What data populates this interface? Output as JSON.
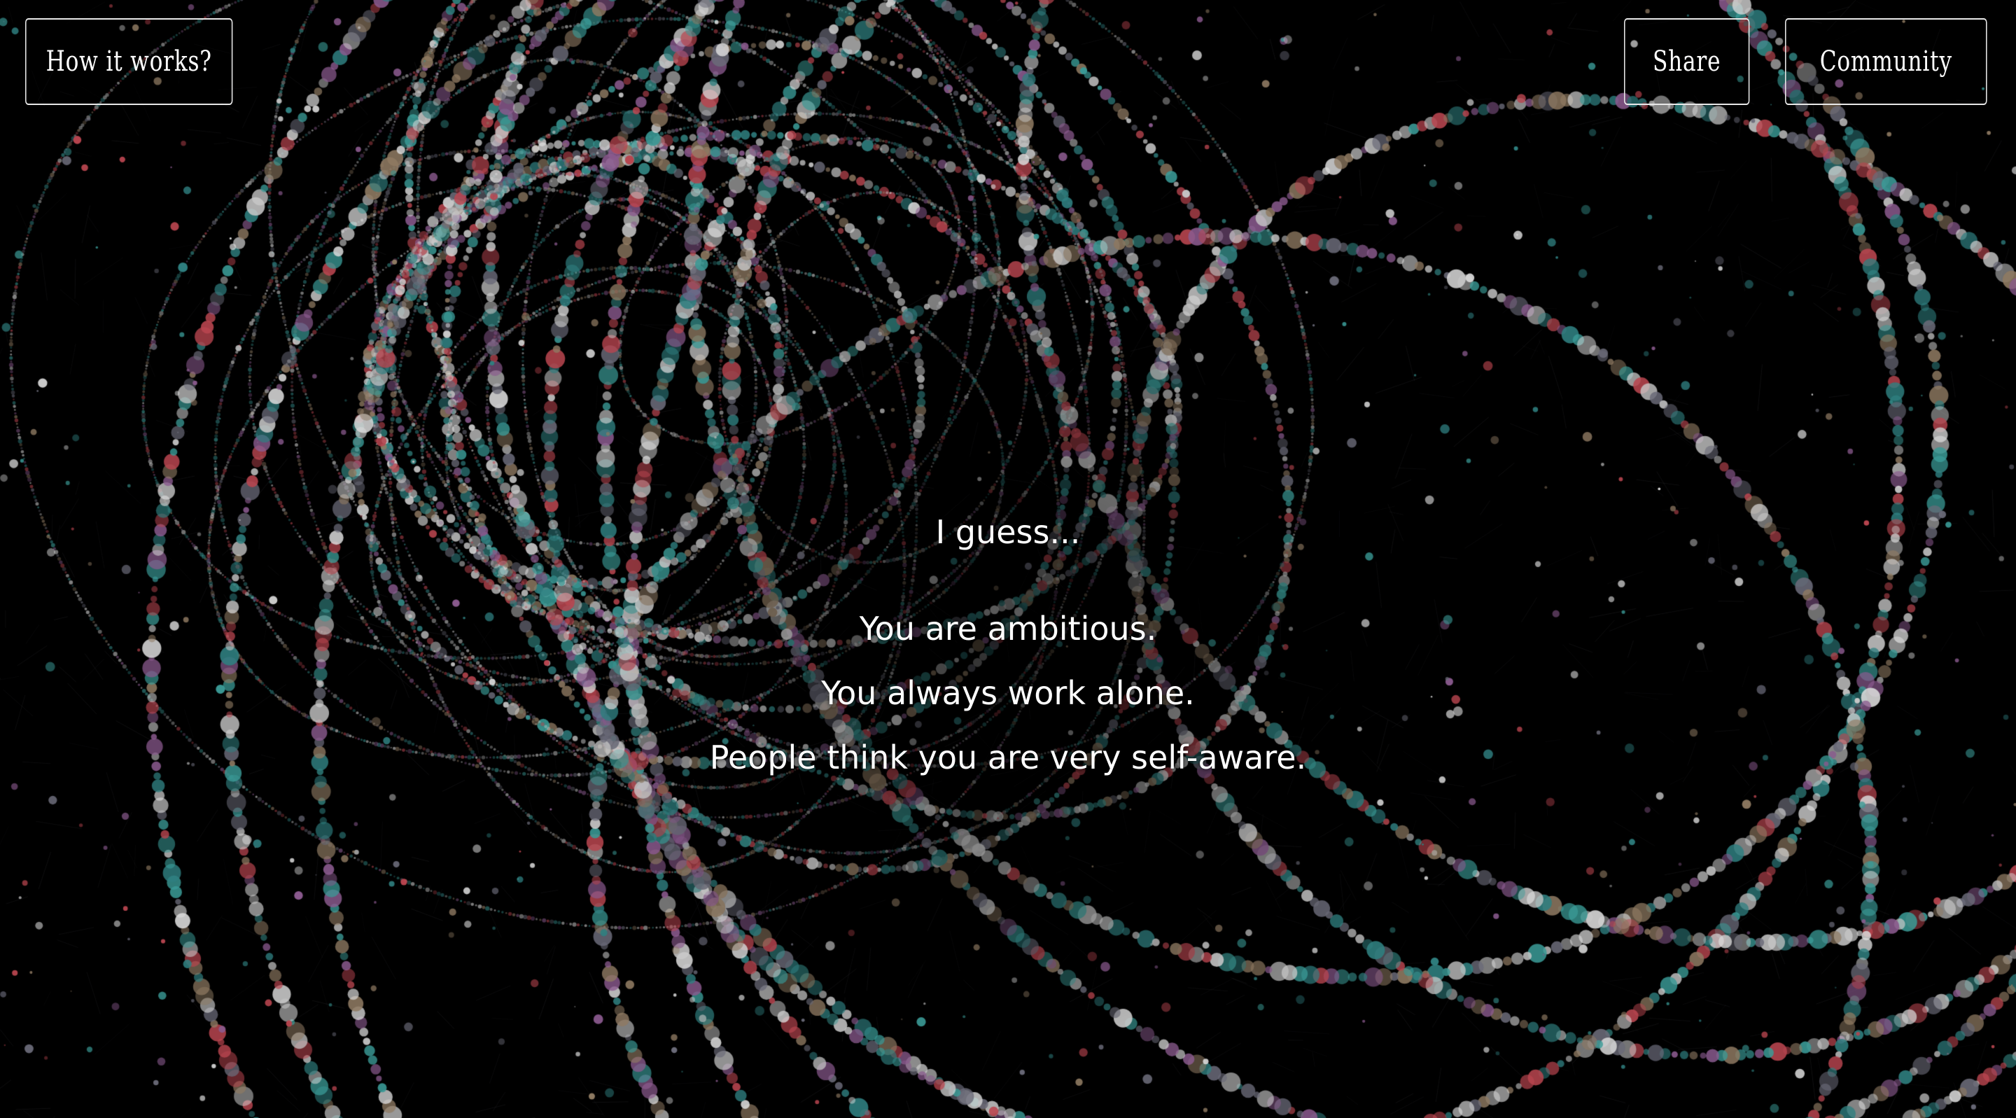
{
  "header": {
    "how_label": "How it works?",
    "share_label": "Share",
    "community_label": "Community"
  },
  "result": {
    "intro": "I guess...",
    "traits": [
      "You are ambitious.",
      "You always work alone.",
      "People think you are very self-aware."
    ]
  },
  "palette": {
    "background": "#000000",
    "dots": [
      "#c8c8c8",
      "#3a9a96",
      "#b8454f",
      "#8a5a8e",
      "#6a6a78",
      "#8f7a62",
      "#d9d9d9",
      "#2f7f80"
    ]
  }
}
